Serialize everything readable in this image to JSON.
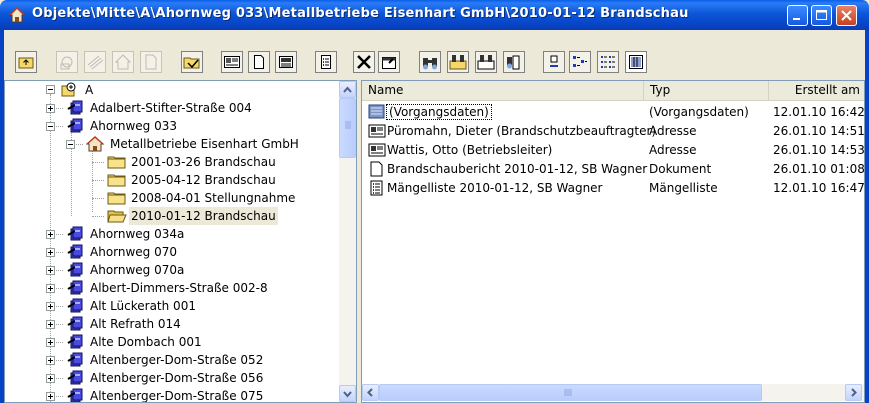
{
  "window": {
    "title": "Objekte\\Mitte\\A\\Ahornweg 033\\Metallbetriebe Eisenhart GmbH\\2010-01-12 Brandschau",
    "colors": {
      "titlebar": "#0842C4",
      "close": "#D9552F",
      "selection": "#316AC5"
    }
  },
  "toolbar": {
    "buttons": [
      {
        "name": "up-folder-icon",
        "enabled": true
      },
      {
        "name": "new-object-icon",
        "enabled": false
      },
      {
        "name": "new-layer-icon",
        "enabled": false
      },
      {
        "name": "new-house-icon",
        "enabled": false
      },
      {
        "name": "new-document-icon",
        "enabled": false
      },
      {
        "name": "open-folder-icon",
        "enabled": true
      },
      {
        "name": "card-view-icon",
        "enabled": true
      },
      {
        "name": "page-icon",
        "enabled": true
      },
      {
        "name": "print-icon",
        "enabled": true
      },
      {
        "name": "list-check-icon",
        "enabled": true
      },
      {
        "name": "delete-icon",
        "enabled": true
      },
      {
        "name": "properties-icon",
        "enabled": true
      },
      {
        "name": "search-icon",
        "enabled": true
      },
      {
        "name": "search-folder-icon",
        "enabled": true
      },
      {
        "name": "search-card-icon",
        "enabled": true
      },
      {
        "name": "search-doc-icon",
        "enabled": true
      },
      {
        "name": "large-icons-icon",
        "enabled": true
      },
      {
        "name": "small-icons-icon",
        "enabled": true
      },
      {
        "name": "list-view-icon",
        "enabled": true
      },
      {
        "name": "details-view-icon",
        "enabled": true
      }
    ]
  },
  "tree": {
    "root": "A",
    "items": [
      {
        "label": "Adalbert-Stifter-Straße 004",
        "type": "object",
        "expanded": false
      },
      {
        "label": "Ahornweg 033",
        "type": "object",
        "expanded": true
      },
      {
        "label": "Metallbetriebe Eisenhart GmbH",
        "type": "company",
        "expanded": true
      },
      {
        "label": "2001-03-26 Brandschau",
        "type": "folder"
      },
      {
        "label": "2005-04-12 Brandschau",
        "type": "folder"
      },
      {
        "label": "2008-04-01 Stellungnahme",
        "type": "folder"
      },
      {
        "label": "2010-01-12 Brandschau",
        "type": "folder-open",
        "selected": true
      },
      {
        "label": "Ahornweg 034a",
        "type": "object",
        "expanded": false
      },
      {
        "label": "Ahornweg 070",
        "type": "object",
        "expanded": false
      },
      {
        "label": "Ahornweg 070a",
        "type": "object",
        "expanded": false
      },
      {
        "label": "Albert-Dimmers-Straße 002-8",
        "type": "object",
        "expanded": false
      },
      {
        "label": "Alt Lückerath 001",
        "type": "object",
        "expanded": false
      },
      {
        "label": "Alt Refrath 014",
        "type": "object",
        "expanded": false
      },
      {
        "label": "Alte Dombach 001",
        "type": "object",
        "expanded": false
      },
      {
        "label": "Altenberger-Dom-Straße 052",
        "type": "object",
        "expanded": false
      },
      {
        "label": "Altenberger-Dom-Straße 056",
        "type": "object",
        "expanded": false
      },
      {
        "label": "Altenberger-Dom-Straße 075",
        "type": "object",
        "expanded": false
      }
    ]
  },
  "list": {
    "columns": [
      "Name",
      "Typ",
      "Erstellt am"
    ],
    "rows": [
      {
        "name": "(Vorgangsdaten)",
        "type": "(Vorgangsdaten)",
        "created": "12.01.10 16:42",
        "icon": "data-icon",
        "selected": true
      },
      {
        "name": "Püromahn, Dieter (Brandschutzbeauftragter)",
        "type": "Adresse",
        "created": "26.01.10 14:51",
        "icon": "address-card-icon"
      },
      {
        "name": "Wattis, Otto (Betriebsleiter)",
        "type": "Adresse",
        "created": "26.01.10 14:53",
        "icon": "address-card-icon"
      },
      {
        "name": "Brandschaubericht 2010-01-12, SB Wagner",
        "type": "Dokument",
        "created": "26.01.10 01:08",
        "icon": "document-icon"
      },
      {
        "name": "Mängelliste 2010-01-12, SB Wagner",
        "type": "Mängelliste",
        "created": "12.01.10 16:47",
        "icon": "checklist-icon"
      }
    ]
  }
}
